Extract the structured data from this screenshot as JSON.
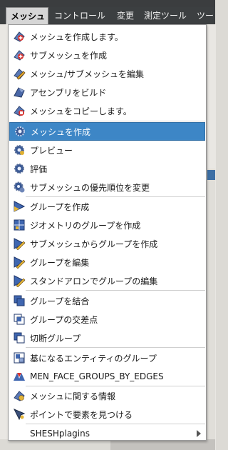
{
  "menubar": {
    "items": [
      {
        "label": "メッシュ",
        "active": true
      },
      {
        "label": "コントロール"
      },
      {
        "label": "変更"
      },
      {
        "label": "測定ツール"
      },
      {
        "label": "ツー"
      }
    ]
  },
  "menu": {
    "items": [
      {
        "label": "メッシュを作成します。",
        "icon": "create-mesh-icon"
      },
      {
        "label": "サブメッシュを作成",
        "icon": "create-submesh-icon"
      },
      {
        "label": "メッシュ/サブメッシュを編集",
        "icon": "edit-mesh-icon"
      },
      {
        "label": "アセンブリをビルド",
        "icon": "build-assembly-icon"
      },
      {
        "label": "メッシュをコピーします。",
        "icon": "copy-mesh-icon"
      },
      {
        "label": "メッシュを作成",
        "icon": "compute-gear-icon",
        "highlighted": true
      },
      {
        "label": "プレビュー",
        "icon": "preview-gear-icon"
      },
      {
        "label": "評価",
        "icon": "evaluate-gear-icon"
      },
      {
        "label": "サブメッシュの優先順位を変更",
        "icon": "priority-gear-icon"
      },
      {
        "label": "グループを作成",
        "icon": "create-group-icon"
      },
      {
        "label": "ジオメトリのグループを作成",
        "icon": "geometry-group-icon"
      },
      {
        "label": "サブメッシュからグループを作成",
        "icon": "submesh-group-icon"
      },
      {
        "label": "グループを編集",
        "icon": "edit-group-icon"
      },
      {
        "label": "スタンドアロンでグループの編集",
        "icon": "standalone-edit-group-icon"
      },
      {
        "label": "グループを結合",
        "icon": "union-group-icon"
      },
      {
        "label": "グループの交差点",
        "icon": "intersect-group-icon"
      },
      {
        "label": "切断グループ",
        "icon": "cut-group-icon"
      },
      {
        "label": "基になるエンティティのグループ",
        "icon": "underlying-entities-group-icon"
      },
      {
        "label": "MEN_FACE_GROUPS_BY_EDGES",
        "icon": "face-groups-by-edges-icon"
      },
      {
        "label": "メッシュに関する情報",
        "icon": "mesh-info-icon"
      },
      {
        "label": "ポイントで要素を見つける",
        "icon": "find-element-by-point-icon"
      },
      {
        "label": "SHESHplagins",
        "icon": "",
        "submenu": true
      }
    ]
  },
  "colors": {
    "highlight": "#3d86c6",
    "menubar": "#3c3f41"
  }
}
